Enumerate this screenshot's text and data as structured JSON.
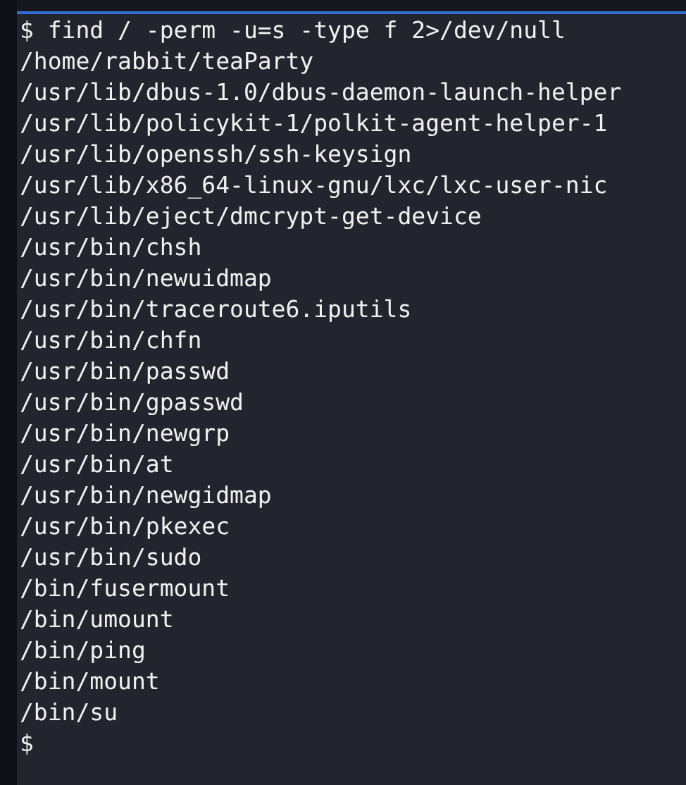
{
  "terminal": {
    "command": "$ find / -perm -u=s -type f 2>/dev/null",
    "output": [
      "/home/rabbit/teaParty",
      "/usr/lib/dbus-1.0/dbus-daemon-launch-helper",
      "/usr/lib/policykit-1/polkit-agent-helper-1",
      "/usr/lib/openssh/ssh-keysign",
      "/usr/lib/x86_64-linux-gnu/lxc/lxc-user-nic",
      "/usr/lib/eject/dmcrypt-get-device",
      "/usr/bin/chsh",
      "/usr/bin/newuidmap",
      "/usr/bin/traceroute6.iputils",
      "/usr/bin/chfn",
      "/usr/bin/passwd",
      "/usr/bin/gpasswd",
      "/usr/bin/newgrp",
      "/usr/bin/at",
      "/usr/bin/newgidmap",
      "/usr/bin/pkexec",
      "/usr/bin/sudo",
      "/bin/fusermount",
      "/bin/umount",
      "/bin/ping",
      "/bin/mount",
      "/bin/su"
    ],
    "prompt": "$"
  }
}
